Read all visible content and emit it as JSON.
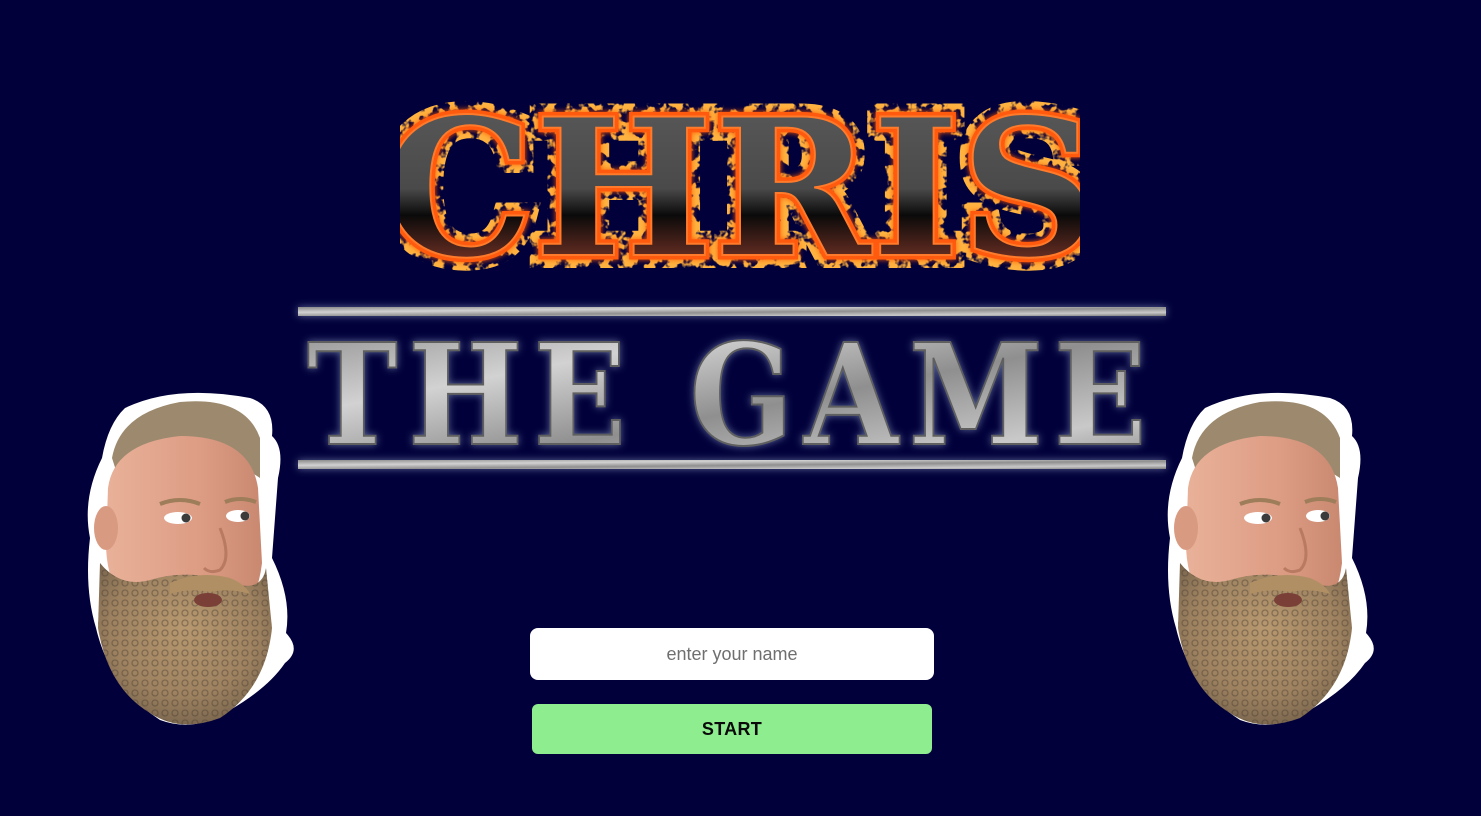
{
  "logo": {
    "title_text": "CHRIS",
    "subtitle_text": "THE GAME"
  },
  "characters": {
    "left_name": "chris-head",
    "right_name": "chris-head"
  },
  "form": {
    "name_placeholder": "enter your name",
    "name_value": "",
    "start_label": "START"
  },
  "colors": {
    "background": "#01003a",
    "start_button": "#8eed8e",
    "input_background": "#ffffff",
    "fire_orange": "#ff6a00",
    "metal_grey": "#a9a9a9"
  }
}
